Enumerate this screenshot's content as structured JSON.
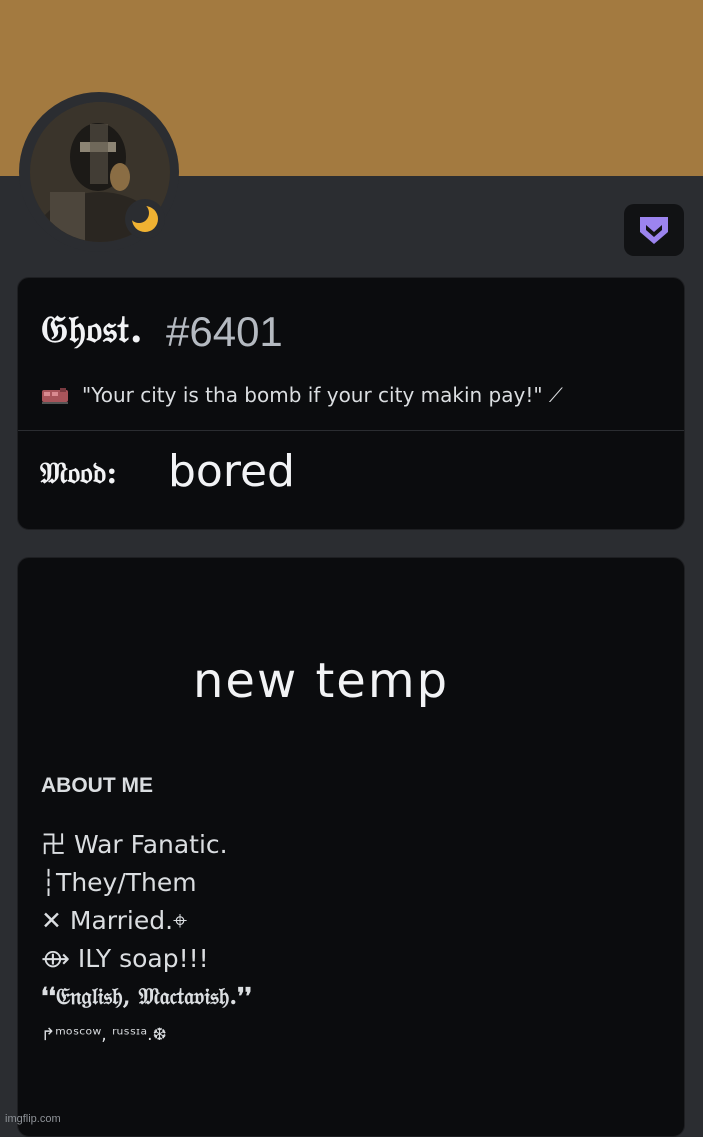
{
  "colors": {
    "banner": "#a37a40",
    "background": "#2b2d31",
    "card": "#0b0c0e",
    "status_idle": "#f0b232",
    "hypesquad": "#9c84ef"
  },
  "icons": {
    "status": "idle-moon-icon",
    "badge": "hypesquad-icon",
    "status_emoji": "train-emoji-icon"
  },
  "profile": {
    "display_name": "𝔊𝔥𝔬𝔰𝔱.",
    "discriminator": "#6401",
    "custom_status": "\"Your city is tha bomb if your city makin pay!\" ⟋",
    "mood_label": "𝔐𝔬𝔬𝔡:",
    "mood_value": "bored"
  },
  "about": {
    "temp_text": "new temp",
    "heading": "ABOUT ME",
    "lines": [
      "卍 War Fanatic.",
      "┆They/Them",
      "✕ Married.⌖",
      "⟴ ILY soap!!!",
      "❛❛𝔈𝔫𝔤𝔩𝔦𝔰𝔥, 𝔐𝔞𝔠𝔱𝔞𝔳𝔦𝔰𝔥.❜❜",
      "↱ᵐᵒˢᶜᵒʷ, ʳᵘˢˢᶦᵃ.❆"
    ]
  },
  "watermark": "imgflip.com"
}
